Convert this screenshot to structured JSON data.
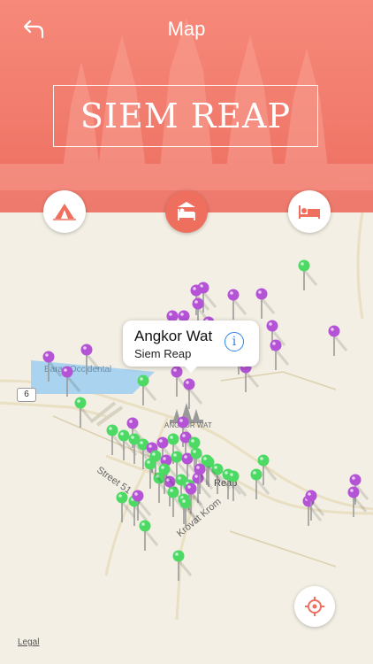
{
  "header": {
    "title": "Map",
    "city": "SIEM REAP",
    "back_icon": "back-arrow-icon"
  },
  "categories": [
    {
      "name": "tent",
      "icon": "tent-icon",
      "active": false
    },
    {
      "name": "hotel-bed",
      "icon": "hotel-bed-icon",
      "active": true
    },
    {
      "name": "bed",
      "icon": "bed-icon",
      "active": false
    }
  ],
  "map": {
    "callout": {
      "title": "Angkor Wat",
      "subtitle": "Siem Reap",
      "info_icon": "info-icon"
    },
    "labels": {
      "lake": "Baray Occidental",
      "road_shield": "6",
      "street51": "Street 51",
      "krovat": "Krovat Krom",
      "angkor": "ANGKOR WAT",
      "reap": "Reap"
    },
    "legal": "Legal",
    "locate_icon": "locate-icon",
    "pin_colors": {
      "attraction": "#b453d6",
      "restaurant": "#4cd964",
      "stem": "#9a9a9a"
    }
  }
}
